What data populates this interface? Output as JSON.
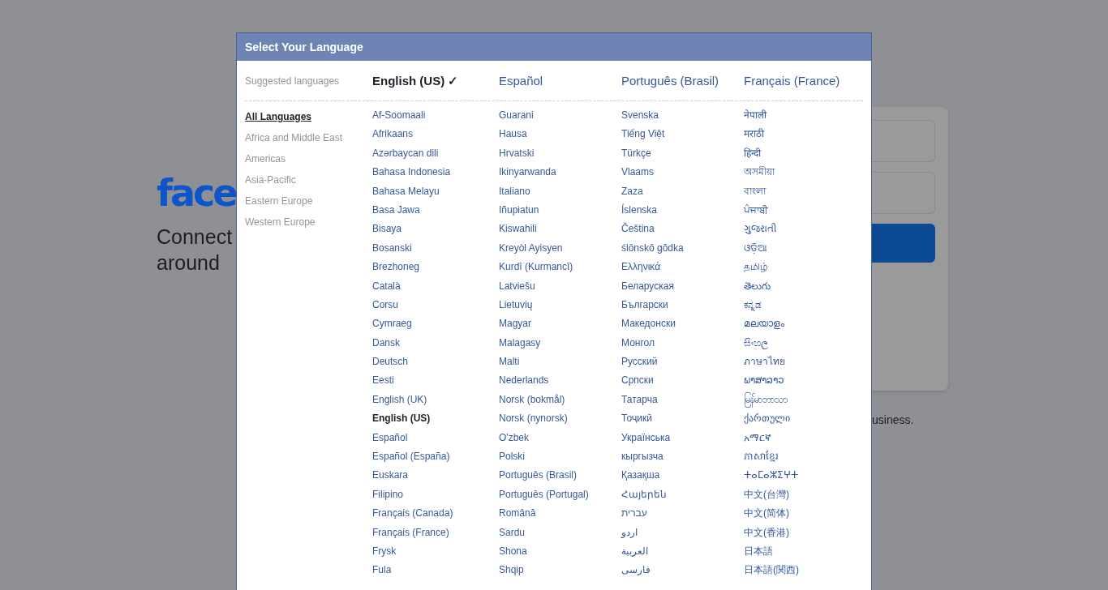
{
  "background": {
    "logo": "face",
    "tagline_lines": [
      "Connect",
      "around"
    ],
    "footer_text": "usiness."
  },
  "dialog": {
    "title": "Select Your Language",
    "suggested_label": "Suggested languages",
    "suggested": [
      {
        "label": "English (US) ✓",
        "selected": true
      },
      {
        "label": "Español",
        "selected": false
      },
      {
        "label": "Português (Brasil)",
        "selected": false
      },
      {
        "label": "Français (France)",
        "selected": false
      }
    ],
    "regions": [
      {
        "label": "All Languages",
        "selected": true
      },
      {
        "label": "Africa and Middle East",
        "selected": false
      },
      {
        "label": "Americas",
        "selected": false
      },
      {
        "label": "Asia-Pacific",
        "selected": false
      },
      {
        "label": "Eastern Europe",
        "selected": false
      },
      {
        "label": "Western Europe",
        "selected": false
      }
    ],
    "columns": [
      [
        {
          "label": "Af-Soomaali",
          "selected": false
        },
        {
          "label": "Afrikaans",
          "selected": false
        },
        {
          "label": "Azərbaycan dili",
          "selected": false
        },
        {
          "label": "Bahasa Indonesia",
          "selected": false
        },
        {
          "label": "Bahasa Melayu",
          "selected": false
        },
        {
          "label": "Basa Jawa",
          "selected": false
        },
        {
          "label": "Bisaya",
          "selected": false
        },
        {
          "label": "Bosanski",
          "selected": false
        },
        {
          "label": "Brezhoneg",
          "selected": false
        },
        {
          "label": "Català",
          "selected": false
        },
        {
          "label": "Corsu",
          "selected": false
        },
        {
          "label": "Cymraeg",
          "selected": false
        },
        {
          "label": "Dansk",
          "selected": false
        },
        {
          "label": "Deutsch",
          "selected": false
        },
        {
          "label": "Eesti",
          "selected": false
        },
        {
          "label": "English (UK)",
          "selected": false
        },
        {
          "label": "English (US)",
          "selected": true
        },
        {
          "label": "Español",
          "selected": false
        },
        {
          "label": "Español (España)",
          "selected": false
        },
        {
          "label": "Euskara",
          "selected": false
        },
        {
          "label": "Filipino",
          "selected": false
        },
        {
          "label": "Français (Canada)",
          "selected": false
        },
        {
          "label": "Français (France)",
          "selected": false
        },
        {
          "label": "Frysk",
          "selected": false
        },
        {
          "label": "Fula",
          "selected": false
        }
      ],
      [
        {
          "label": "Guarani",
          "selected": false
        },
        {
          "label": "Hausa",
          "selected": false
        },
        {
          "label": "Hrvatski",
          "selected": false
        },
        {
          "label": "Ikinyarwanda",
          "selected": false
        },
        {
          "label": "Italiano",
          "selected": false
        },
        {
          "label": "Iñupiatun",
          "selected": false
        },
        {
          "label": "Kiswahili",
          "selected": false
        },
        {
          "label": "Kreyòl Ayisyen",
          "selected": false
        },
        {
          "label": "Kurdî (Kurmancî)",
          "selected": false
        },
        {
          "label": "Latviešu",
          "selected": false
        },
        {
          "label": "Lietuvių",
          "selected": false
        },
        {
          "label": "Magyar",
          "selected": false
        },
        {
          "label": "Malagasy",
          "selected": false
        },
        {
          "label": "Malti",
          "selected": false
        },
        {
          "label": "Nederlands",
          "selected": false
        },
        {
          "label": "Norsk (bokmål)",
          "selected": false
        },
        {
          "label": "Norsk (nynorsk)",
          "selected": false
        },
        {
          "label": "O'zbek",
          "selected": false
        },
        {
          "label": "Polski",
          "selected": false
        },
        {
          "label": "Português (Brasil)",
          "selected": false
        },
        {
          "label": "Português (Portugal)",
          "selected": false
        },
        {
          "label": "Română",
          "selected": false
        },
        {
          "label": "Sardu",
          "selected": false
        },
        {
          "label": "Shona",
          "selected": false
        },
        {
          "label": "Shqip",
          "selected": false
        }
      ],
      [
        {
          "label": "Svenska",
          "selected": false
        },
        {
          "label": "Tiếng Việt",
          "selected": false
        },
        {
          "label": "Türkçe",
          "selected": false
        },
        {
          "label": "Vlaams",
          "selected": false
        },
        {
          "label": "Zaza",
          "selected": false
        },
        {
          "label": "Íslenska",
          "selected": false
        },
        {
          "label": "Čeština",
          "selected": false
        },
        {
          "label": "ślōnskō gŏdka",
          "selected": false
        },
        {
          "label": "Ελληνικά",
          "selected": false
        },
        {
          "label": "Беларуская",
          "selected": false
        },
        {
          "label": "Български",
          "selected": false
        },
        {
          "label": "Македонски",
          "selected": false
        },
        {
          "label": "Монгол",
          "selected": false
        },
        {
          "label": "Русский",
          "selected": false
        },
        {
          "label": "Српски",
          "selected": false
        },
        {
          "label": "Татарча",
          "selected": false
        },
        {
          "label": "Тоҷикӣ",
          "selected": false
        },
        {
          "label": "Українська",
          "selected": false
        },
        {
          "label": "кыргызча",
          "selected": false
        },
        {
          "label": "Қазақша",
          "selected": false
        },
        {
          "label": "Հայերեն",
          "selected": false
        },
        {
          "label": "עברית",
          "selected": false
        },
        {
          "label": "اردو",
          "selected": false
        },
        {
          "label": "العربية",
          "selected": false
        },
        {
          "label": "فارسی",
          "selected": false
        }
      ],
      [
        {
          "label": "नेपाली",
          "selected": false
        },
        {
          "label": "मराठी",
          "selected": false
        },
        {
          "label": "हिन्दी",
          "selected": false
        },
        {
          "label": "অসমীয়া",
          "selected": false
        },
        {
          "label": "বাংলা",
          "selected": false
        },
        {
          "label": "ਪੰਜਾਬੀ",
          "selected": false
        },
        {
          "label": "ગુજરાતી",
          "selected": false
        },
        {
          "label": "ଓଡ଼ିଆ",
          "selected": false
        },
        {
          "label": "தமிழ்",
          "selected": false
        },
        {
          "label": "తెలుగు",
          "selected": false
        },
        {
          "label": "ಕನ್ನಡ",
          "selected": false
        },
        {
          "label": "മലയാളം",
          "selected": false
        },
        {
          "label": "සිංහල",
          "selected": false
        },
        {
          "label": "ภาษาไทย",
          "selected": false
        },
        {
          "label": "ພາສາລາວ",
          "selected": false
        },
        {
          "label": "မြန်မာဘာသာ",
          "selected": false
        },
        {
          "label": "ქართული",
          "selected": false
        },
        {
          "label": "አማርኛ",
          "selected": false
        },
        {
          "label": "ភាសាខ្មែរ",
          "selected": false
        },
        {
          "label": "ⵜⴰⵎⴰⵣⵉⵖⵜ",
          "selected": false
        },
        {
          "label": "中文(台灣)",
          "selected": false
        },
        {
          "label": "中文(简体)",
          "selected": false
        },
        {
          "label": "中文(香港)",
          "selected": false
        },
        {
          "label": "日本語",
          "selected": false
        },
        {
          "label": "日本語(関西)",
          "selected": false
        }
      ]
    ]
  }
}
